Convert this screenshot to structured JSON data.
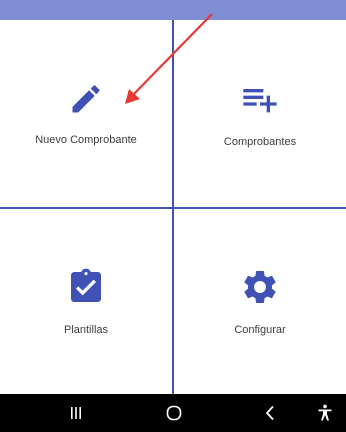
{
  "colors": {
    "status_bar": "#7e8fd3",
    "accent": "#3f51b5",
    "annotation_arrow": "#e53935",
    "nav_bar": "#000000"
  },
  "tiles": [
    {
      "label": "Nuevo Comprobante",
      "icon": "pencil-icon"
    },
    {
      "label": "Comprobantes",
      "icon": "playlist-add-icon"
    },
    {
      "label": "Plantillas",
      "icon": "clipboard-check-icon"
    },
    {
      "label": "Configurar",
      "icon": "gear-icon"
    }
  ],
  "navigation_bar": {
    "buttons": [
      "recents-icon",
      "home-icon",
      "back-icon",
      "accessibility-icon"
    ]
  }
}
